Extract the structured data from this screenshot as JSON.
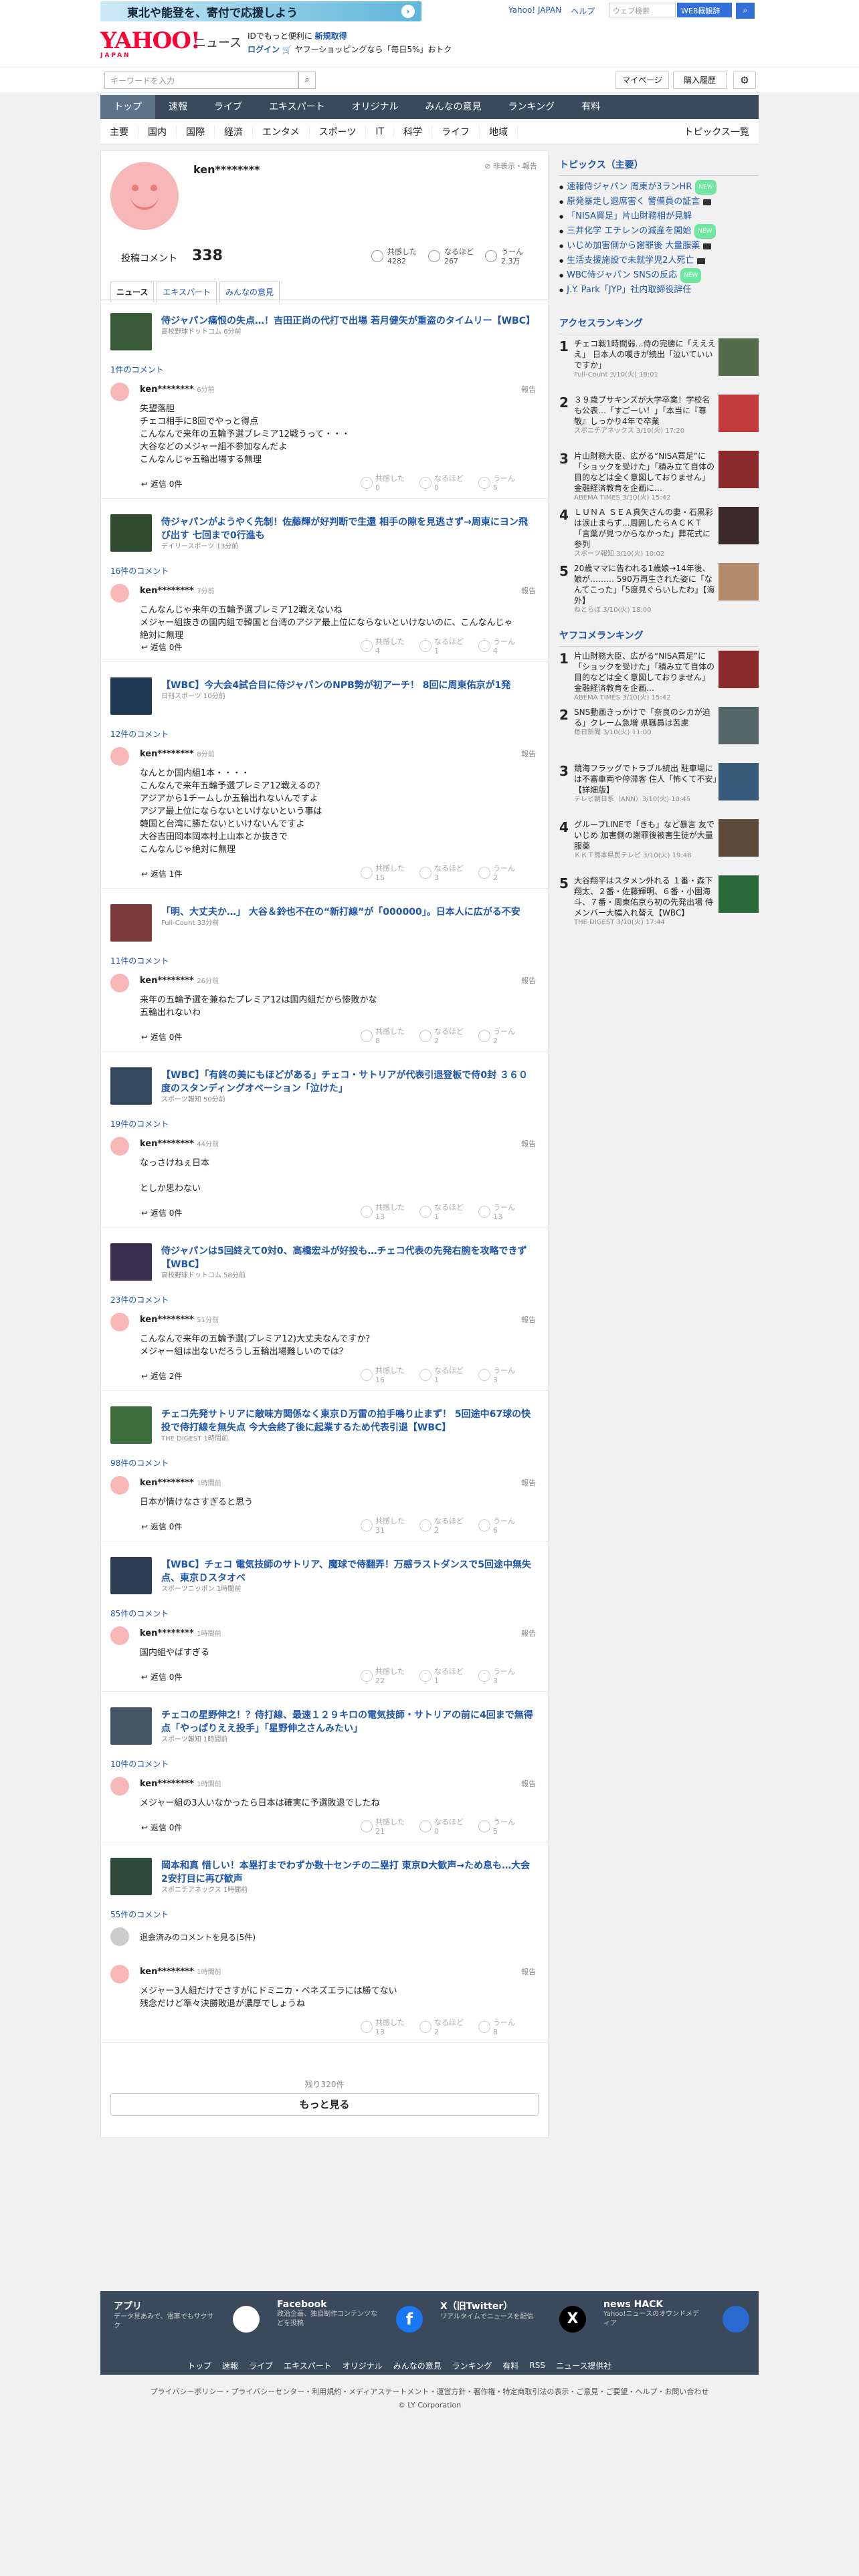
{
  "topbar": {
    "banner": "東北や能登を、寄付で応援しよう",
    "links": [
      "Yahoo! JAPAN",
      "ヘルプ"
    ],
    "search_placeholder": "ウェブ検索",
    "search_button": "WEB概観辞"
  },
  "header": {
    "logo": "YAHOO!",
    "logo_sub": "JAPAN",
    "news": "ニュース",
    "promo_line1_a": "IDでもっと便利に",
    "promo_line1_b": "新規取得",
    "promo_line2_a": "ログイン",
    "promo_line2_b": "ヤフーショッピングなら「毎日5%」おトク"
  },
  "search": {
    "placeholder": "キーワードを入力",
    "mypage": "マイページ",
    "history": "購入履歴"
  },
  "nav": [
    "トップ",
    "速報",
    "ライブ",
    "エキスパート",
    "オリジナル",
    "みんなの意見",
    "ランキング",
    "有料"
  ],
  "subnav": [
    "主要",
    "国内",
    "国際",
    "経済",
    "エンタメ",
    "スポーツ",
    "IT",
    "科学",
    "ライフ",
    "地域"
  ],
  "subnav_right": "トピックス一覧",
  "profile": {
    "username": "ken********",
    "privacy": "非表示・報告",
    "comment_label": "投稿コメント",
    "comment_count": "338",
    "stats": [
      {
        "label": "共感した",
        "value": "4282"
      },
      {
        "label": "なるほど",
        "value": "267"
      },
      {
        "label": "うーん",
        "value": "2.3万"
      }
    ],
    "tabs": [
      "ニュース",
      "エキスパート",
      "みんなの意見"
    ]
  },
  "labels": {
    "reply": "返信",
    "report": "報告",
    "agree": "共感した",
    "hmm": "なるほど",
    "uun": "うーん"
  },
  "items": [
    {
      "title": "侍ジャパン痛恨の失点…！吉田正尚の代打で出場 若月健矢が重盗のタイムリー【WBC】",
      "source": "高校野球ドットコム 6分前",
      "count": "1件のコメント",
      "user": "ken********",
      "time": "6分前",
      "text": "失望落胆\nチェコ相手に8回でやっと得点\nこんなんで来年の五輪予選プレミア12戦うって・・・\n大谷などのメジャー組不参加なんだよ\nこんなんじゃ五輪出場する無理",
      "reply": "返信 0件",
      "r": [
        "0",
        "0",
        "5"
      ],
      "thumb": "#3b5a3a"
    },
    {
      "title": "侍ジャパンがようやく先制！佐藤輝が好判断で生還 相手の隙を見逃さず→周東にヨン飛び出す 七回まで0行進も",
      "source": "デイリースポーツ 13分前",
      "count": "16件のコメント",
      "user": "ken********",
      "time": "7分前",
      "text": "こんなんじゃ来年の五輪予選プレミア12戦えないね\nメジャー組抜きの国内組で韓国と台湾のアジア最上位にならないといけないのに、こんなんじゃ絶対に無理",
      "reply": "返信 0件",
      "r": [
        "4",
        "1",
        "4"
      ],
      "thumb": "#2f4a2f"
    },
    {
      "title": "【WBC】今大会4試合目に侍ジャパンのNPB勢が初アーチ！ 8回に周東佑京が1発",
      "source": "日刊スポーツ 10分前",
      "count": "12件のコメント",
      "user": "ken********",
      "time": "8分前",
      "text": "なんとか国内組1本・・・・\nこんなんで来年五輪予選プレミア12戦えるの？\nアジアから1チームしか五輪出れないんですよ\nアジア最上位にならないといけないという事は\n韓国と台湾に勝たないといけないんですよ\n大谷吉田岡本岡本村上山本とか抜きで\nこんなんじゃ絶対に無理",
      "reply": "返信 1件",
      "r": [
        "15",
        "3",
        "2"
      ],
      "thumb": "#203a55"
    },
    {
      "title": "「明、大丈夫か…」 大谷＆鈴也不在の“新打線”が「000000」。日本人に広がる不安",
      "source": "Full-Count 33分前",
      "count": "11件のコメント",
      "user": "ken********",
      "time": "26分前",
      "text": "来年の五輪予選を兼ねたプレミア12は国内組だから惨敗かな\n五輪出れないわ",
      "reply": "返信 0件",
      "r": [
        "8",
        "2",
        "2"
      ],
      "thumb": "#7a3a3a"
    },
    {
      "title": "【WBC】「有終の美にもほどがある」チェコ・サトリアが代表引退登板で侍0封 ３６０度のスタンディングオベーション「泣けた」",
      "source": "スポーツ報知 50分前",
      "count": "19件のコメント",
      "user": "ken********",
      "time": "44分前",
      "text": "なっさけねぇ日本\n\nとしか思わない",
      "reply": "返信 0件",
      "r": [
        "13",
        "1",
        "13"
      ],
      "thumb": "#34495e"
    },
    {
      "title": "侍ジャパンは5回終えて0対0、高橋宏斗が好投も…チェコ代表の先発右腕を攻略できず【WBC】",
      "source": "高校野球ドットコム 58分前",
      "count": "23件のコメント",
      "user": "ken********",
      "time": "51分前",
      "text": "こんなんで来年の五輪予選(プレミア12)大丈夫なんですか？\nメジャー組は出ないだろうし五輪出場難しいのでは？",
      "reply": "返信 2件",
      "r": [
        "16",
        "1",
        "3"
      ],
      "thumb": "#3a3050"
    },
    {
      "title": "チェコ先発サトリアに敵味方関係なく東京Ｄ万雷の拍手鳴り止まず！ 5回途中67球の快投で侍打線を無失点 今大会終了後に起業するため代表引退【WBC】",
      "source": "THE DIGEST 1時間前",
      "count": "98件のコメント",
      "user": "ken********",
      "time": "1時間前",
      "text": "日本が情けなさすぎると思う",
      "reply": "返信 0件",
      "r": [
        "31",
        "2",
        "6"
      ],
      "thumb": "#3c6e3c"
    },
    {
      "title": "【WBC】チェコ 電気技師のサトリア、魔球で侍翻弄！万感ラストダンスで5回途中無失点、東京Ｄスタオベ",
      "source": "スポーツニッポン 1時間前",
      "count": "85件のコメント",
      "user": "ken********",
      "time": "1時間前",
      "text": "国内組やばすぎる",
      "reply": "返信 0件",
      "r": [
        "22",
        "1",
        "3"
      ],
      "thumb": "#2f3d55"
    },
    {
      "title": "チェコの星野伸之！？侍打線、最速１２９キロの電気技師・サトリアの前に4回まで無得点「やっぱりええ投手」「星野伸之さんみたい」",
      "source": "スポーツ報知 1時間前",
      "count": "10件のコメント",
      "user": "ken********",
      "time": "1時間前",
      "text": "メジャー組の3人いなかったら日本は確実に予選敗退でしたね",
      "reply": "返信 0件",
      "r": [
        "21",
        "0",
        "5"
      ],
      "thumb": "#445566"
    },
    {
      "title": "岡本和真 惜しい！本塁打までわずか数十センチの二塁打 東京D大歓声→ため息も…大会2安打目に再び歓声",
      "source": "スポニチアネックス 1時間前",
      "count": "55件のコメント",
      "user": "ken********",
      "time": "1時間前",
      "text": "メジャー3人組だけでさすがにドミニカ・ベネズエラには勝てない\n残念だけど準々決勝敗退が濃厚でしょうね",
      "deleted": "退会済みのコメントを見る(5件)",
      "reply": "",
      "r": [
        "13",
        "2",
        "8"
      ],
      "thumb": "#2f4a3a"
    }
  ],
  "remaining": "残り320件",
  "more": "もっと見る",
  "side": {
    "topics_title": "トピックス（主要）",
    "topics": [
      {
        "t": "速報侍ジャパン 周東が3ランHR",
        "b": "NEW"
      },
      {
        "t": "原発暴走し退席害く 警備員の証言",
        "b": "cam"
      },
      {
        "t": "「NISA買足」片山財務相が見解",
        "b": ""
      },
      {
        "t": "三井化学 エチレンの減産を開始",
        "b": "NEW"
      },
      {
        "t": "いじめ加害側から謝罪後 大量服薬",
        "b": "cam"
      },
      {
        "t": "生活支援施設で未就学児2人死亡",
        "b": "cam"
      },
      {
        "t": "WBC侍ジャパン SNSの反応",
        "b": "NEW"
      },
      {
        "t": "J.Y. Park「JYP」社内取締役辞任",
        "b": ""
      }
    ],
    "access_title": "アクセスランキング",
    "access": [
      {
        "t": "チェコ戦1時間弱…侍の完勝に「ええええ」 日本人の嘆きが続出「泣いていいですか」",
        "s": "Full-Count 3/10(火) 18:01",
        "c": "#556a4a"
      },
      {
        "t": "３９歳ブサキンズが大学卒業！学校名も公表…「すごーい！」「本当に『尊敬』しっかり4年で卒業",
        "s": "スポニチアネックス 3/10(火) 17:20",
        "c": "#c23a3a"
      },
      {
        "t": "片山財務大臣、広がる“NISA買足”に「ショックを受けた」「積み立て自体の目的などは全く意図しておりません」金融経済教育を企画に…",
        "s": "ABEMA TIMES 3/10(火) 15:42",
        "c": "#8a2a2a"
      },
      {
        "t": "ＬＵＮＡ ＳＥＡ真矢さんの妻・石黒彩は涙止まらず…周囲したらＡＣＫＴ「言葉が見つからなかった」葬花式に参列",
        "s": "スポーツ報知 3/10(火) 10:02",
        "c": "#3a2a2a"
      },
      {
        "t": "20歳ママに告われる1歳娘→14年後、娘が……… 590万再生された姿に「なんてこった」「5度見ぐらいしたわ」【海外】",
        "s": "ねとらぼ 3/10(火) 18:00",
        "c": "#b08a6a"
      }
    ],
    "yafoo_title": "ヤフコメランキング",
    "yafoo": [
      {
        "t": "片山財務大臣、広がる“NISA買足”に「ショックを受けた」「積み立て自体の目的などは全く意図しておりません」金融経済教育を企画…",
        "s": "ABEMA TIMES 3/10(火) 15:42",
        "c": "#8a2a2a"
      },
      {
        "t": "SNS動画きっかけで「奈良のシカが迫る」クレーム急増 県職員は苦慮",
        "s": "毎日新聞 3/10(火) 11:00",
        "c": "#556666"
      },
      {
        "t": "競海フラッグでトラブル続出 駐車場には不審車両や停滞客 住人「怖くて不安」【詳細版】",
        "s": "テレビ朝日系（ANN）3/10(火) 10:45",
        "c": "#3a5a7a"
      },
      {
        "t": "グループLINEで「きも」など暴言 友でいじめ 加害側の謝罪後被害生徒が大量服薬",
        "s": "ＫＫＴ熊本県民テレビ 3/10(火) 19:48",
        "c": "#5a4a3a"
      },
      {
        "t": "大谷翔平はスタメン外れる １番・森下翔太、２番・佐藤輝明、６番・小園海斗、７番・周東佑京ら初の先発出場 侍メンバー大幅入れ替え【WBC】",
        "s": "THE DIGEST 3/10(火) 17:44",
        "c": "#2a6a3a"
      }
    ]
  },
  "footer": {
    "cols": [
      {
        "title": "アプリ",
        "desc": "データ見あみで、電車でもサクサク"
      },
      {
        "title": "Facebook",
        "desc": "政治企画、独自制作コンテンツなどを投稿"
      },
      {
        "title": "X（旧Twitter）",
        "desc": "リアルタイムでニュースを配信"
      },
      {
        "title": "news HACK",
        "desc": "Yahoo!ニュースのオウンドメディア"
      }
    ],
    "links": [
      "トップ",
      "速報",
      "ライブ",
      "エキスパート",
      "オリジナル",
      "みんなの意見",
      "ランキング",
      "有料",
      "RSS",
      "ニュース提供社"
    ],
    "legal": "プライバシーポリシー・プライバシーセンター・利用規約・メディアステートメント・運営方針・著作権・特定商取引法の表示・ご意見・ご要望・ヘルプ・お問い合わせ",
    "copy": "© LY Corporation"
  }
}
